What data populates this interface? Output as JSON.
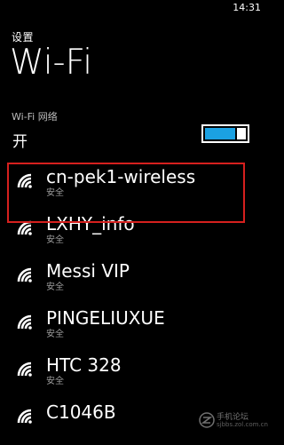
{
  "status_bar": {
    "time": "14:31"
  },
  "app_title": "设置",
  "page_title": "Wi-Fi",
  "wifi_toggle": {
    "label": "Wi-Fi 网络",
    "state": "开",
    "on": true,
    "accent": "#1ba1e2"
  },
  "networks": [
    {
      "name": "cn-pek1-wireless",
      "status": "安全"
    },
    {
      "name": "LXHY_info",
      "status": "安全"
    },
    {
      "name": "Messi VIP",
      "status": "安全"
    },
    {
      "name": "PINGELIUXUE",
      "status": "安全"
    },
    {
      "name": "HTC 328",
      "status": "安全"
    },
    {
      "name": "C1046B",
      "status": ""
    }
  ],
  "highlight_color": "#d6201e",
  "watermark": {
    "line1": "手机论坛",
    "line2": "sjbbs.zol.com.cn"
  },
  "icons": {
    "network": "wifi-signal-icon",
    "watermark": "zol-logo-icon"
  }
}
